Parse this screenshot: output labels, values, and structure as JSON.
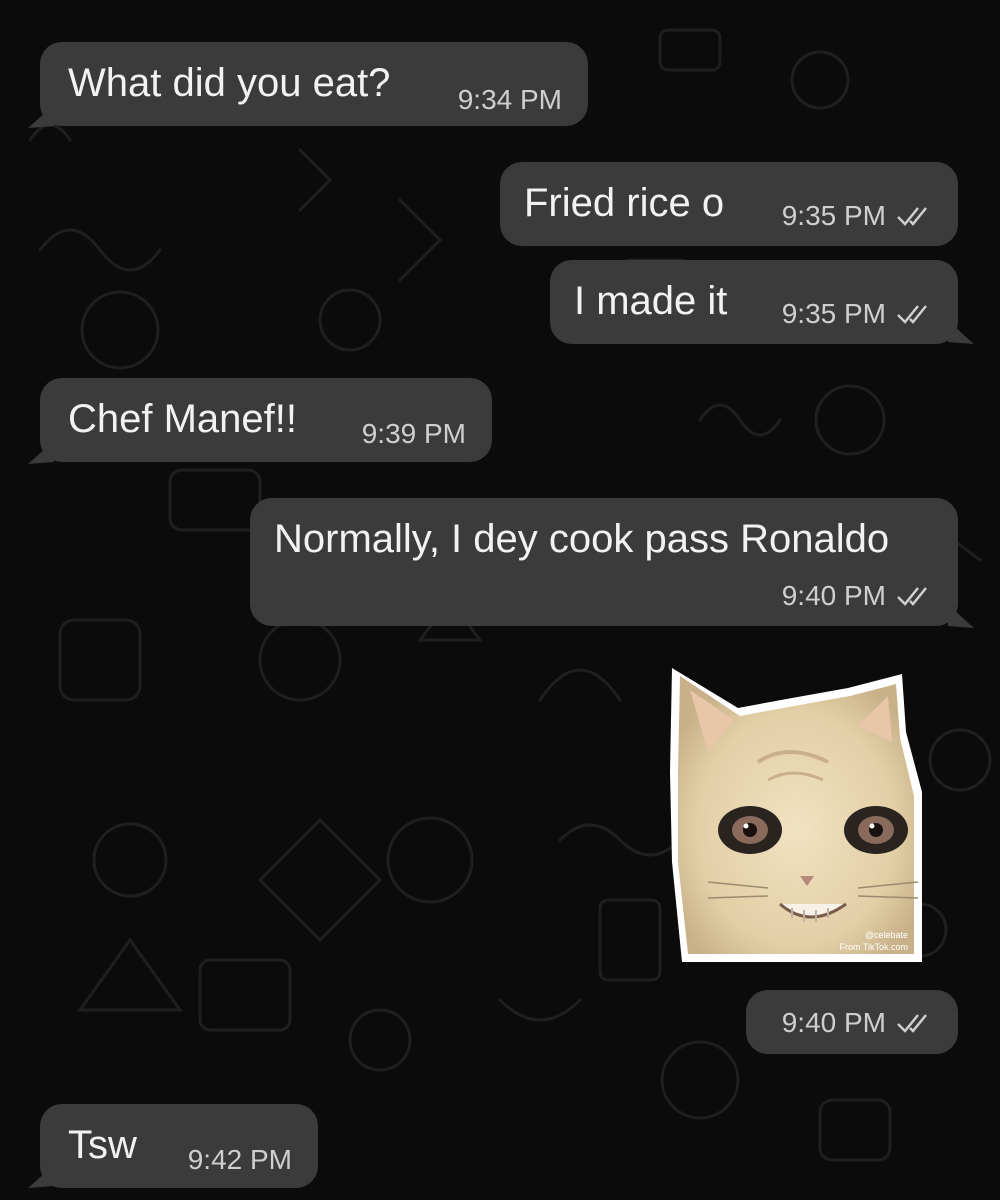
{
  "messages": [
    {
      "direction": "in",
      "text": "What did you eat?",
      "time": "9:34 PM"
    },
    {
      "direction": "out",
      "text": "Fried rice o",
      "time": "9:35 PM",
      "status": "read"
    },
    {
      "direction": "out",
      "text": "I made it",
      "time": "9:35 PM",
      "status": "read"
    },
    {
      "direction": "in",
      "text": "Chef Manef!!",
      "time": "9:39 PM"
    },
    {
      "direction": "out",
      "text": "Normally, I dey cook pass Ronaldo",
      "time": "9:40 PM",
      "status": "read"
    },
    {
      "direction": "out",
      "type": "sticker",
      "sticker": {
        "label": "@celebate",
        "source": "From TikTok.com"
      },
      "time": "9:40 PM",
      "status": "read"
    },
    {
      "direction": "in",
      "text": "Tsw",
      "time": "9:42 PM"
    }
  ],
  "icons": {
    "read_status": "double-check-icon",
    "sticker": "cat-sticker-icon"
  },
  "colors": {
    "background": "#0b0b0b",
    "bubble": "#3b3b3b",
    "text": "#f2f2f2",
    "meta": "#cfcfcf"
  }
}
